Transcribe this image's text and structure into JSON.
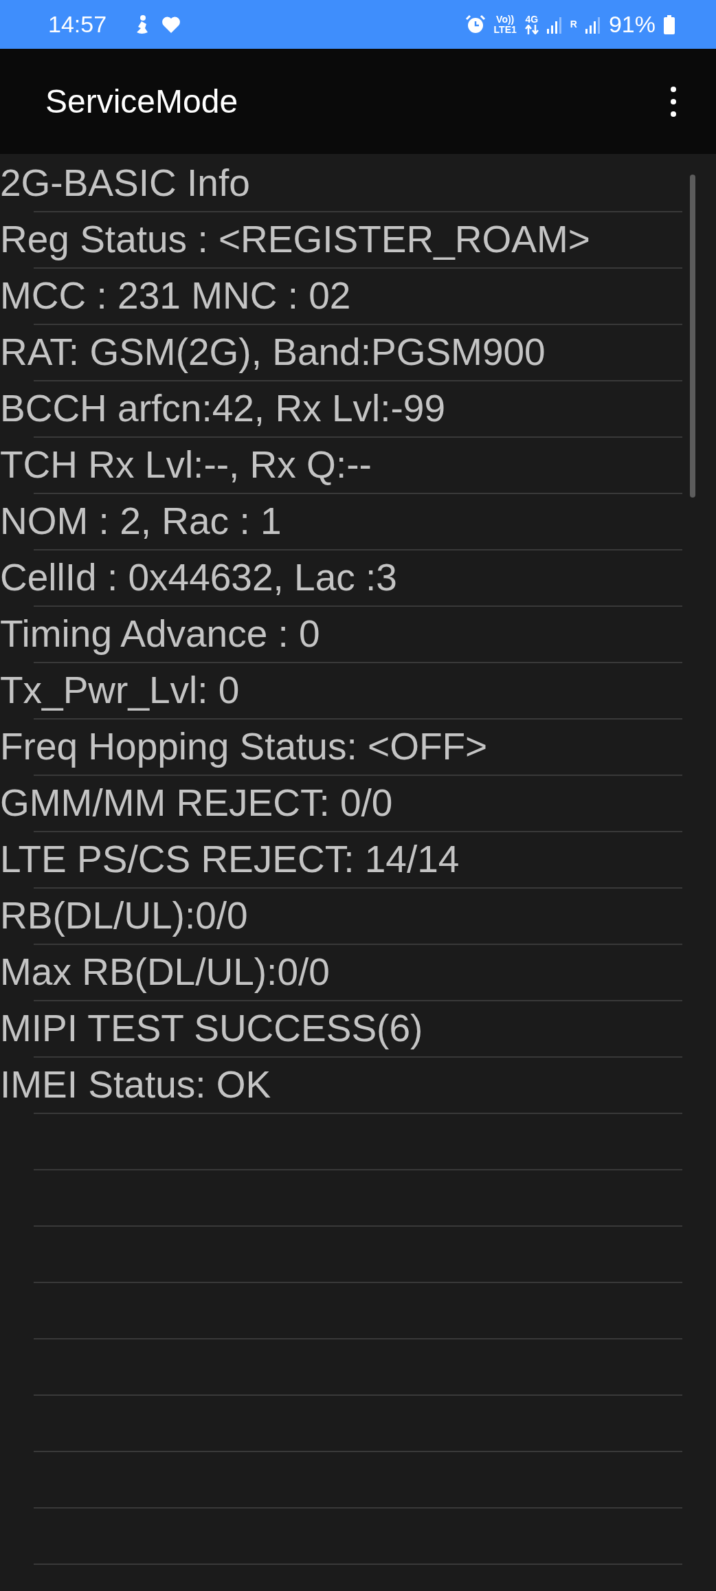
{
  "status_bar": {
    "time": "14:57",
    "volte": "Vo))",
    "lte": "LTE1",
    "network": "4G",
    "roaming": "R",
    "battery": "91%"
  },
  "app_bar": {
    "title": "ServiceMode"
  },
  "rows": [
    "2G-BASIC Info",
    "Reg Status : <REGISTER_ROAM>",
    "MCC : 231 MNC : 02",
    "RAT: GSM(2G), Band:PGSM900",
    "BCCH arfcn:42, Rx Lvl:-99",
    "TCH Rx Lvl:--, Rx Q:--",
    "NOM : 2, Rac : 1",
    "CellId : 0x44632, Lac :3",
    "Timing Advance : 0",
    "Tx_Pwr_Lvl: 0",
    "Freq Hopping Status: <OFF>",
    "GMM/MM REJECT: 0/0",
    "LTE PS/CS REJECT: 14/14",
    "RB(DL/UL):0/0",
    "Max RB(DL/UL):0/0",
    "MIPI TEST SUCCESS(6)",
    "IMEI Status: OK"
  ]
}
